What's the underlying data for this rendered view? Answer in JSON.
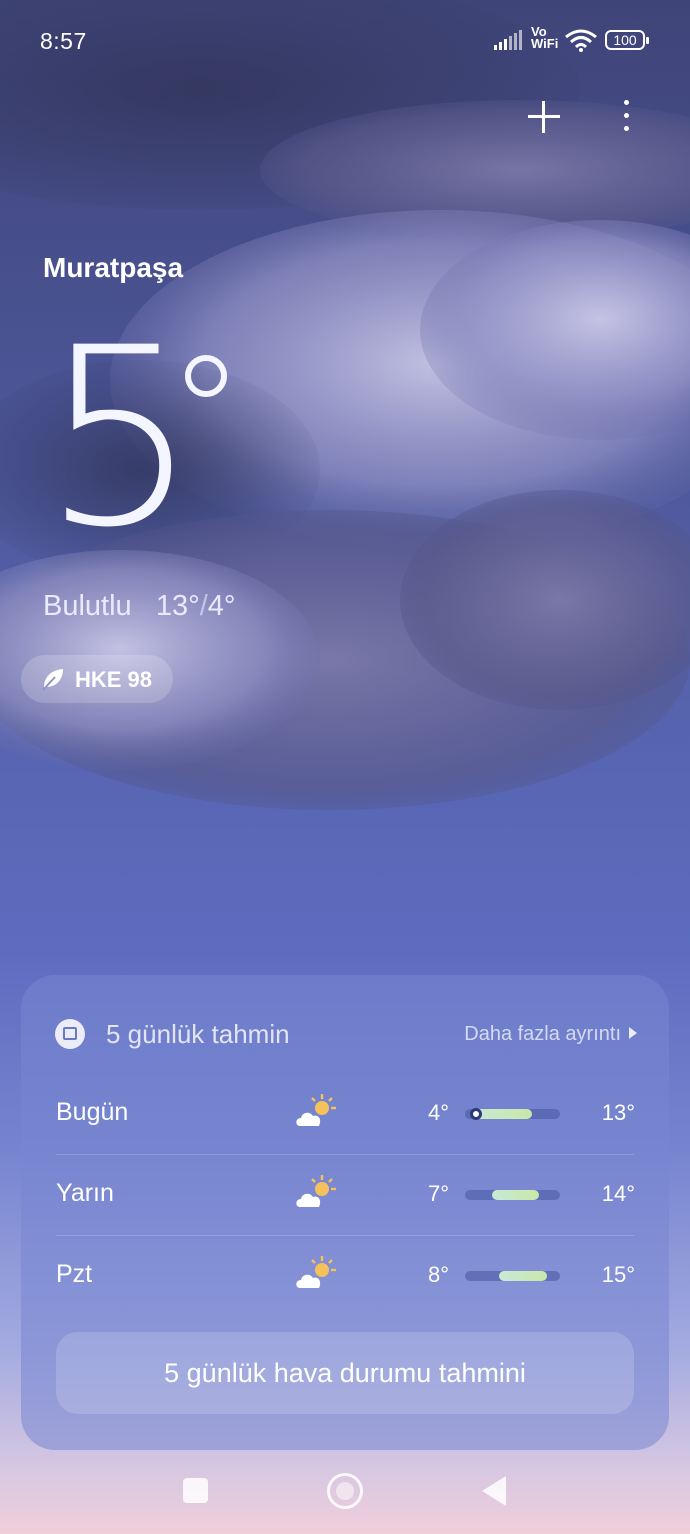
{
  "status_bar": {
    "time": "8:57",
    "network_label": "Vo WiFi",
    "battery": "100",
    "icons": [
      "signal-icon",
      "wifi-icon",
      "battery-icon"
    ]
  },
  "toolbar": {
    "add_icon": "plus-icon",
    "menu_icon": "more-vertical-icon"
  },
  "location": {
    "city": "Muratpaşa"
  },
  "current": {
    "temperature": "5",
    "condition": "Bulutlu",
    "high": "13°",
    "low": "4°"
  },
  "aqi": {
    "label": "HKE 98",
    "icon": "leaf-icon"
  },
  "forecast_card": {
    "title": "5 günlük tahmin",
    "more_link": "Daha fazla ayrıntı",
    "days": [
      {
        "day": "Bugün",
        "icon": "partly-cloudy-icon",
        "low": "4°",
        "high": "13°",
        "range_start": 0.05,
        "range_end": 0.7,
        "current_marker": 0.12
      },
      {
        "day": "Yarın",
        "icon": "partly-cloudy-icon",
        "low": "7°",
        "high": "14°",
        "range_start": 0.28,
        "range_end": 0.78
      },
      {
        "day": "Pzt",
        "icon": "partly-cloudy-icon",
        "low": "8°",
        "high": "15°",
        "range_start": 0.36,
        "range_end": 0.86
      }
    ],
    "button_label": "5 günlük hava durumu tahmini"
  },
  "colors": {
    "bar_fill": "#c8e7a8",
    "card_bg": "#7887d2"
  }
}
